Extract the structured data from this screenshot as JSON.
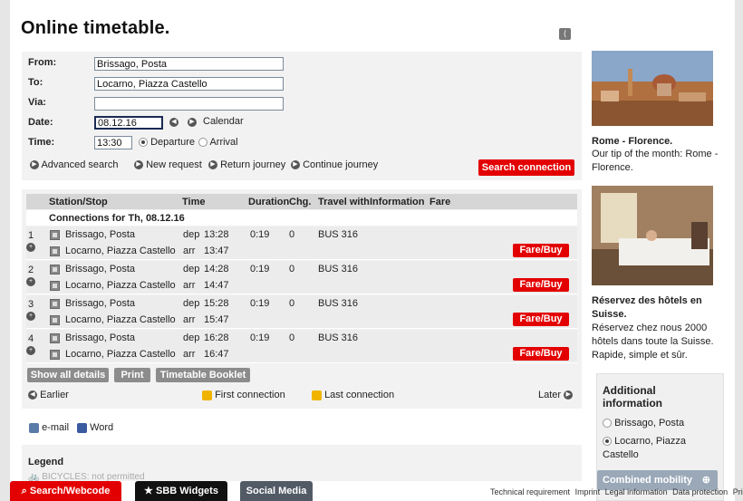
{
  "page_title": "Online timetable.",
  "form": {
    "from_label": "From:",
    "from_value": "Brissago, Posta",
    "to_label": "To:",
    "to_value": "Locarno, Piazza Castello",
    "via_label": "Via:",
    "via_value": "",
    "date_label": "Date:",
    "date_value": "08.12.16",
    "calendar_label": "Calendar",
    "time_label": "Time:",
    "time_value": "13:30",
    "departure_label": "Departure",
    "arrival_label": "Arrival",
    "advanced_search": "Advanced search",
    "new_request": "New request",
    "return_journey": "Return journey",
    "continue_journey": "Continue journey",
    "search_button": "Search connection"
  },
  "results": {
    "headers": {
      "station": "Station/Stop",
      "time": "Time",
      "duration": "Duration",
      "chg": "Chg.",
      "travel_with": "Travel with",
      "information": "Information",
      "fare": "Fare"
    },
    "connections_title": "Connections for Th, 08.12.16",
    "rows": [
      {
        "num": "1",
        "from": "Brissago, Posta",
        "to": "Locarno, Piazza Castello",
        "dep_label": "dep",
        "dep": "13:28",
        "arr_label": "arr",
        "arr": "13:47",
        "duration": "0:19",
        "chg": "0",
        "travel": "BUS 316",
        "fare": "Fare/Buy"
      },
      {
        "num": "2",
        "from": "Brissago, Posta",
        "to": "Locarno, Piazza Castello",
        "dep_label": "dep",
        "dep": "14:28",
        "arr_label": "arr",
        "arr": "14:47",
        "duration": "0:19",
        "chg": "0",
        "travel": "BUS 316",
        "fare": "Fare/Buy"
      },
      {
        "num": "3",
        "from": "Brissago, Posta",
        "to": "Locarno, Piazza Castello",
        "dep_label": "dep",
        "dep": "15:28",
        "arr_label": "arr",
        "arr": "15:47",
        "duration": "0:19",
        "chg": "0",
        "travel": "BUS 316",
        "fare": "Fare/Buy"
      },
      {
        "num": "4",
        "from": "Brissago, Posta",
        "to": "Locarno, Piazza Castello",
        "dep_label": "dep",
        "dep": "16:28",
        "arr_label": "arr",
        "arr": "16:47",
        "duration": "0:19",
        "chg": "0",
        "travel": "BUS 316",
        "fare": "Fare/Buy"
      }
    ],
    "show_all_details": "Show all details",
    "print": "Print",
    "timetable_booklet": "Timetable Booklet",
    "earlier": "Earlier",
    "first_connection": "First connection",
    "last_connection": "Last connection",
    "later": "Later"
  },
  "share": {
    "email": "e-mail",
    "word": "Word"
  },
  "legend": {
    "title": "Legend",
    "item": "BICYCLES: not permitted"
  },
  "sidebar": {
    "promo1_title": "Rome - Florence.",
    "promo1_text": "Our tip of the month: Rome - Florence.",
    "promo2_title": "Réservez des hôtels en Suisse.",
    "promo2_text": "Réservez chez nous 2000 hôtels dans toute la Suisse. Rapide, simple et sûr.",
    "additional_title": "Additional information",
    "stop1": "Brissago, Posta",
    "stop2": "Locarno, Piazza Castello",
    "combined_mobility": "Combined mobility"
  },
  "footer": {
    "tab1": "Search/Webcode",
    "tab2": "SBB Widgets",
    "tab3": "Social Media",
    "links": [
      "Technical requirement",
      "Imprint",
      "Legal information",
      "Data protection",
      "Print"
    ]
  },
  "colors": {
    "accent_red": "#e30000",
    "grey_button": "#8c8c8c",
    "panel_bg": "#f2f2f2"
  }
}
